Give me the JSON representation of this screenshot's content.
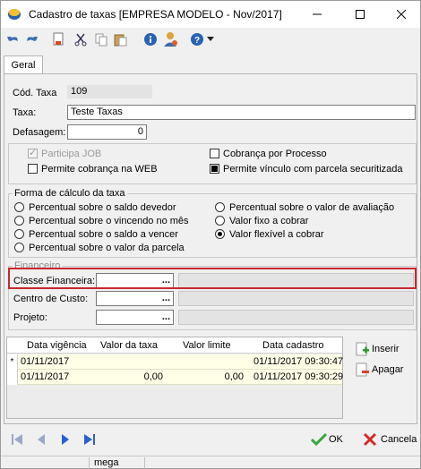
{
  "window": {
    "title": "Cadastro de taxas [EMPRESA MODELO - Nov/2017]"
  },
  "toolbar": {
    "icons": [
      "undo-icon",
      "redo-icon",
      "new-doc-icon",
      "cut-icon",
      "copy-icon",
      "paste-icon",
      "info-icon",
      "user-icon",
      "help-icon",
      "dropdown-arrow-icon"
    ]
  },
  "tabs": [
    {
      "label": "Geral"
    }
  ],
  "form": {
    "cod_label": "Cód. Taxa",
    "cod_value": "109",
    "taxa_label": "Taxa:",
    "taxa_value": "Teste Taxas",
    "defasagem_label": "Defasagem:",
    "defasagem_value": "0",
    "participa_job": "Participa JOB",
    "cobranca_processo": "Cobrança por Processo",
    "permite_web": "Permite cobrança na WEB",
    "permite_vinculo": "Permite vínculo com parcela securitizada"
  },
  "forma": {
    "title": "Forma de cálculo da taxa",
    "options": [
      "Percentual sobre o saldo devedor",
      "Percentual sobre o vincendo no mês",
      "Percentual sobre o saldo a vencer",
      "Percentual sobre o valor da parcela",
      "Percentual sobre o valor de avaliação",
      "Valor fixo a cobrar",
      "Valor flexível a cobrar"
    ],
    "selected": "Valor flexível a cobrar"
  },
  "financeiro": {
    "title": "Financeiro",
    "classe_label": "Classe Financeira:",
    "centro_label": "Centro de Custo:",
    "projeto_label": "Projeto:",
    "lookup": "..."
  },
  "grid": {
    "columns": [
      "Data vigência",
      "Valor da taxa",
      "Valor limite",
      "Data cadastro"
    ],
    "rows": [
      {
        "indicator": "*",
        "data_vigencia": "01/11/2017",
        "valor_taxa": "",
        "valor_limite": "",
        "data_cadastro": "01/11/2017 09:30:47"
      },
      {
        "indicator": "",
        "data_vigencia": "01/11/2017",
        "valor_taxa": "0,00",
        "valor_limite": "0,00",
        "data_cadastro": "01/11/2017 09:30:29"
      }
    ]
  },
  "actions": {
    "inserir": "Inserir",
    "apagar": "Apagar",
    "ok": "OK",
    "cancela": "Cancela"
  },
  "status": {
    "user": "mega"
  },
  "colors": {
    "highlight": "#c8282d",
    "row_bg": "#ffffe8",
    "accent_blue": "#2a5fa8"
  }
}
